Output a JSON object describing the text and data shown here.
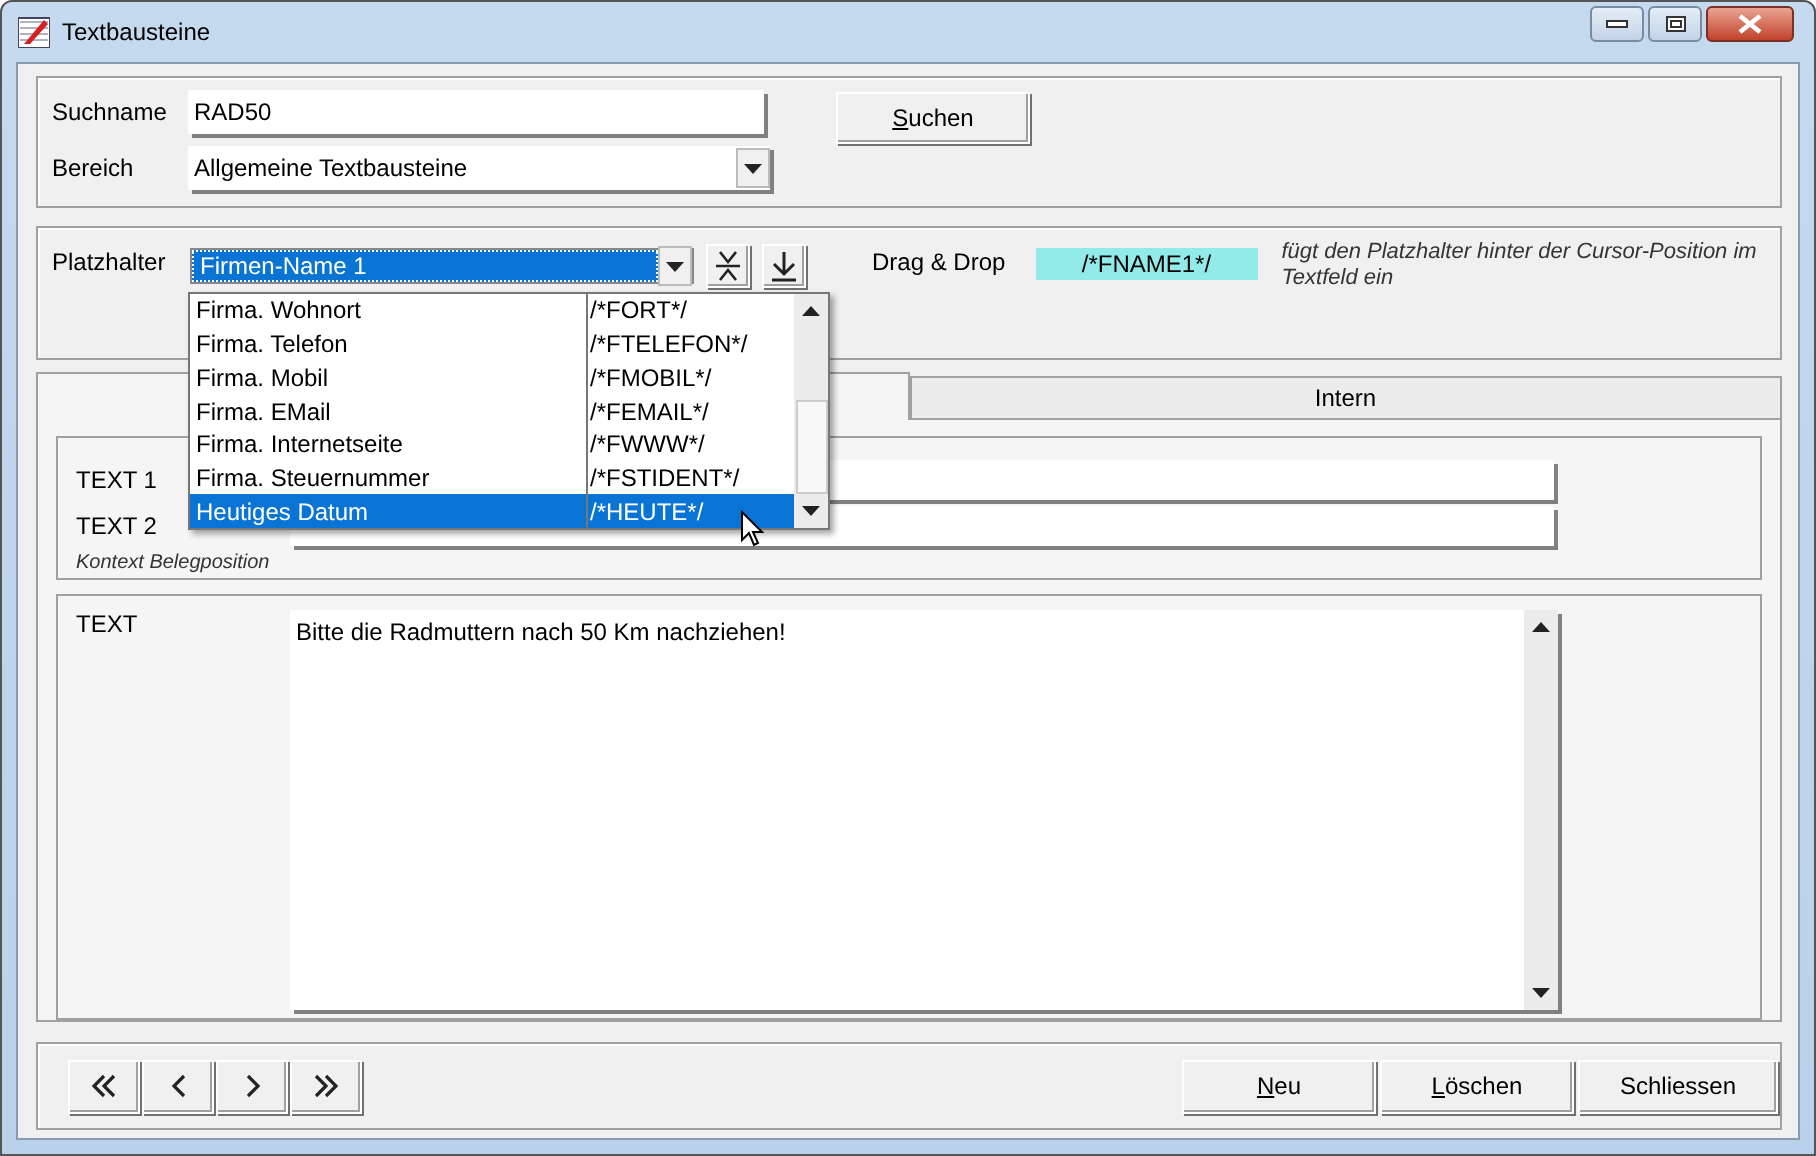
{
  "window": {
    "title": "Textbausteine"
  },
  "search": {
    "suchname_label": "Suchname",
    "suchname_value": "RAD50",
    "bereich_label": "Bereich",
    "bereich_value": "Allgemeine Textbausteine",
    "button": {
      "label": "Suchen",
      "underlined_key": true
    }
  },
  "platzhalter": {
    "label": "Platzhalter",
    "value": "Firmen-Name 1",
    "drag_label": "Drag & Drop",
    "drag_value": "/*FNAME1*/",
    "hint": "fügt den Platzhalter hinter der Cursor-Position im Textfeld ein",
    "options": [
      {
        "name": "Firma. Wohnort",
        "code": "/*FORT*/",
        "selected": false
      },
      {
        "name": "Firma. Telefon",
        "code": "/*FTELEFON*/",
        "selected": false
      },
      {
        "name": "Firma. Mobil",
        "code": "/*FMOBIL*/",
        "selected": false
      },
      {
        "name": "Firma. EMail",
        "code": "/*FEMAIL*/",
        "selected": false
      },
      {
        "name": "Firma. Internetseite",
        "code": "/*FWWW*/",
        "selected": false
      },
      {
        "name": "Firma. Steuernummer",
        "code": "/*FSTIDENT*/",
        "selected": false
      },
      {
        "name": "Heutiges Datum",
        "code": "/*HEUTE*/",
        "selected": true
      }
    ]
  },
  "tabs": [
    {
      "selected": true
    },
    {
      "label": "Intern",
      "selected": false
    }
  ],
  "fields": [
    {
      "label": "TEXT 1"
    },
    {
      "label": "TEXT 2"
    }
  ],
  "context_note": "Kontext Belegposition",
  "text": {
    "label": "TEXT",
    "value": "Bitte die Radmuttern nach 50 Km nachziehen!"
  },
  "nav_buttons": [
    {
      "kind": "first"
    },
    {
      "kind": "prev"
    },
    {
      "kind": "next"
    },
    {
      "kind": "last"
    }
  ],
  "actions": [
    {
      "label": "Neu",
      "underlined_key": true
    },
    {
      "label": "Löschen",
      "underlined_key": true
    },
    {
      "label": "Schliessen",
      "underlined_key": false
    }
  ]
}
